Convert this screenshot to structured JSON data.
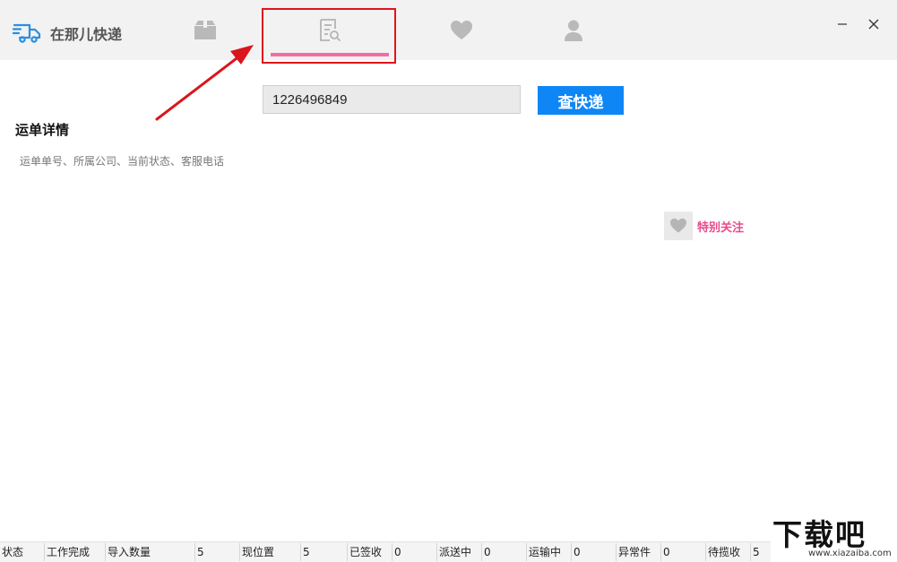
{
  "app": {
    "name": "在那儿快递",
    "brand_color": "#2a8fe0",
    "accent_color": "#f06fa2",
    "tabs": [
      {
        "icon": "package-icon",
        "active": false
      },
      {
        "icon": "search-document-icon",
        "active": true
      },
      {
        "icon": "heart-icon",
        "active": false
      },
      {
        "icon": "user-icon",
        "active": false
      }
    ]
  },
  "search": {
    "value": "1226496849",
    "button_label": "查快递"
  },
  "detail": {
    "title": "运单详情",
    "subtitle": "运单单号、所属公司、当前状态、客服电话"
  },
  "follow": {
    "label": "特别关注"
  },
  "status_bar": [
    {
      "label": "状态",
      "value": "工作完成"
    },
    {
      "label": "导入数量",
      "value": "5"
    },
    {
      "label": "现位置",
      "value": "5"
    },
    {
      "label": "已签收",
      "value": "0"
    },
    {
      "label": "派送中",
      "value": "0"
    },
    {
      "label": "运输中",
      "value": "0"
    },
    {
      "label": "异常件",
      "value": "0"
    },
    {
      "label": "待揽收",
      "value": "5"
    }
  ],
  "watermark": {
    "text": "下载吧",
    "url": "www.xiazaiba.com"
  }
}
